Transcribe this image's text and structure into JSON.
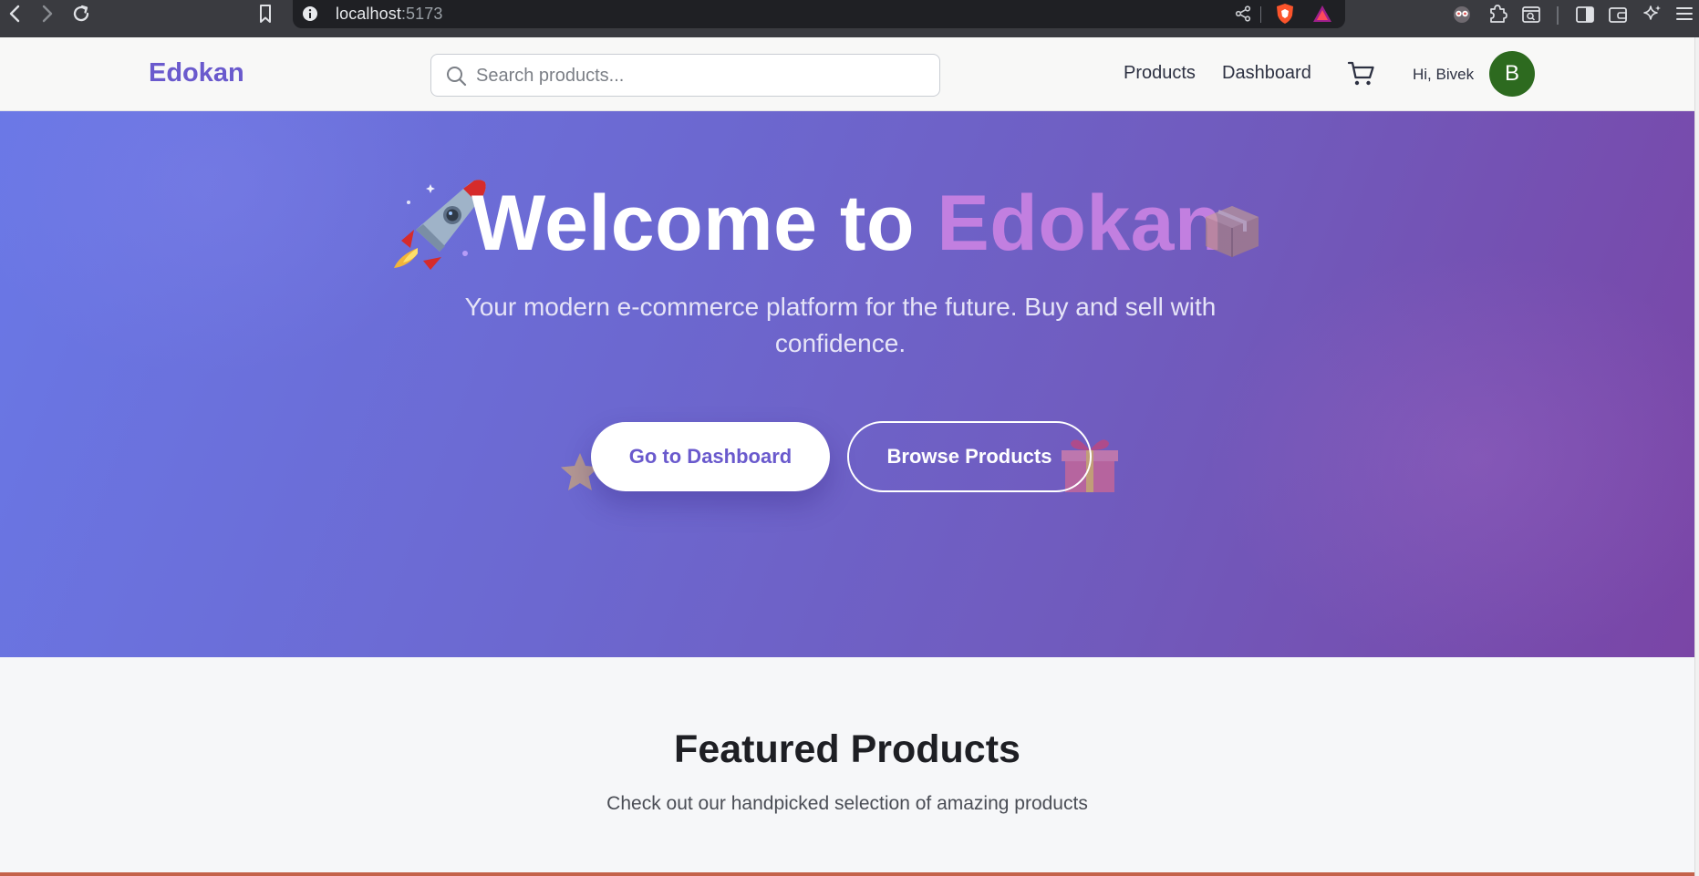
{
  "browser": {
    "url_host": "localhost",
    "url_port": ":5173"
  },
  "navbar": {
    "brand": "Edokan",
    "search_placeholder": "Search products...",
    "links": [
      "Products",
      "Dashboard"
    ],
    "greeting": "Hi, Bivek",
    "avatar_initial": "B"
  },
  "hero": {
    "title_prefix": "Welcome to ",
    "title_accent": "Edokan",
    "subtitle": "Your modern e-commerce platform for the future. Buy and sell with confidence.",
    "primary_button": "Go to Dashboard",
    "secondary_button": "Browse Products"
  },
  "featured": {
    "title": "Featured Products",
    "subtitle": "Check out our handpicked selection of amazing products"
  },
  "colors": {
    "brand": "#6a5acd",
    "accent": "#c27fe0",
    "avatar": "#2d6a1f",
    "hero_start": "#6a78e6",
    "hero_end": "#7a45a6"
  },
  "icons": [
    "back-icon",
    "forward-icon",
    "reload-icon",
    "bookmark-icon",
    "site-info-icon",
    "share-icon",
    "brave-shield-icon",
    "brave-rewards-icon",
    "extension-icon",
    "puzzle-icon",
    "tab-search-icon",
    "sidebar-icon",
    "wallet-icon",
    "leo-ai-icon",
    "menu-icon",
    "search-icon",
    "cart-icon",
    "rocket-icon",
    "box-icon",
    "star-icon",
    "gift-icon"
  ]
}
